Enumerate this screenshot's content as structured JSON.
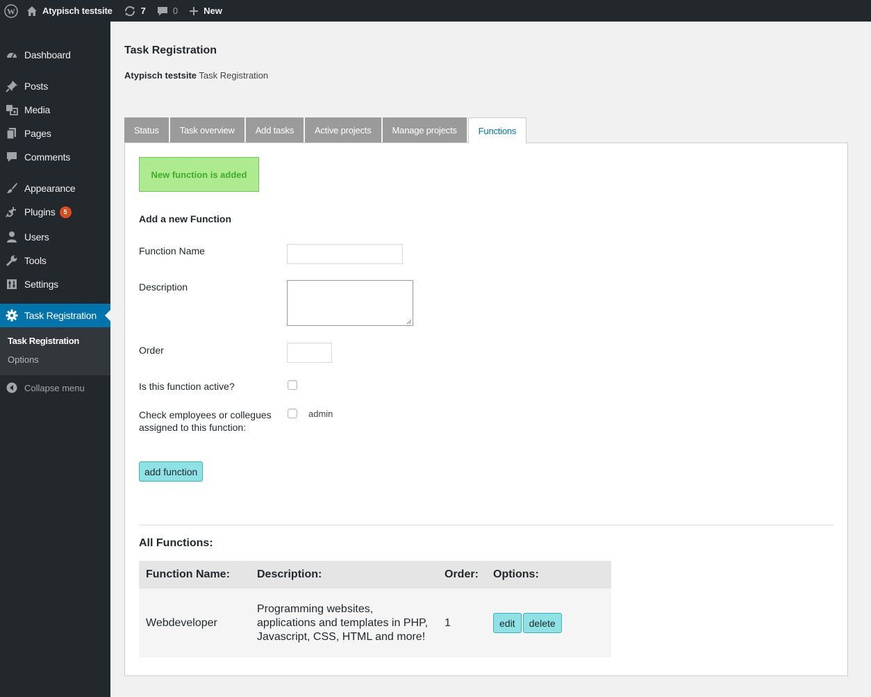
{
  "admin_bar": {
    "site_name": "Atypisch testsite",
    "updates_count": "7",
    "comments_count": "0",
    "new_label": "New"
  },
  "sidebar": {
    "items": [
      {
        "label": "Dashboard",
        "icon": "dashboard-icon"
      },
      {
        "label": "Posts",
        "icon": "pin-icon"
      },
      {
        "label": "Media",
        "icon": "media-icon"
      },
      {
        "label": "Pages",
        "icon": "pages-icon"
      },
      {
        "label": "Comments",
        "icon": "comment-icon"
      },
      {
        "label": "Appearance",
        "icon": "brush-icon"
      },
      {
        "label": "Plugins",
        "icon": "plugin-icon",
        "badge": "5"
      },
      {
        "label": "Users",
        "icon": "user-icon"
      },
      {
        "label": "Tools",
        "icon": "wrench-icon"
      },
      {
        "label": "Settings",
        "icon": "settings-icon"
      },
      {
        "label": "Task Registration",
        "icon": "gear-icon"
      }
    ],
    "submenu": [
      "Task Registration",
      "Options"
    ],
    "collapse_label": "Collapse menu"
  },
  "page": {
    "title": "Task Registration",
    "subtitle_site": "Atypisch testsite",
    "subtitle_rest": " Task Registration"
  },
  "tabs": [
    "Status",
    "Task overview",
    "Add tasks",
    "Active projects",
    "Manage projects",
    "Functions"
  ],
  "notice": "New function is added",
  "form": {
    "section_title": "Add a new Function",
    "function_name_label": "Function Name",
    "function_name_value": "",
    "description_label": "Description",
    "description_value": "",
    "order_label": "Order",
    "order_value": "",
    "active_label": "Is this function active?",
    "active_checked": false,
    "employees_label_line1": "Check employees or collegues",
    "employees_label_line2": "assigned to this function:",
    "employees": [
      {
        "name": "admin",
        "checked": false
      }
    ],
    "submit_label": "add function"
  },
  "all_functions": {
    "title": "All Functions:",
    "columns": [
      "Function Name:",
      "Description:",
      "Order:",
      "Options:"
    ],
    "rows": [
      {
        "name": "Webdeveloper",
        "description": "Programming websites, applications and templates in PHP, Javascript, CSS, HTML and more!",
        "order": "1",
        "edit_label": "edit",
        "delete_label": "delete"
      }
    ]
  },
  "colors": {
    "admin_bar_bg": "#23282d",
    "accent": "#0073aa",
    "notice_bg": "#aeea8f",
    "button_bg": "#8ee1e4",
    "badge": "#d54e21"
  }
}
